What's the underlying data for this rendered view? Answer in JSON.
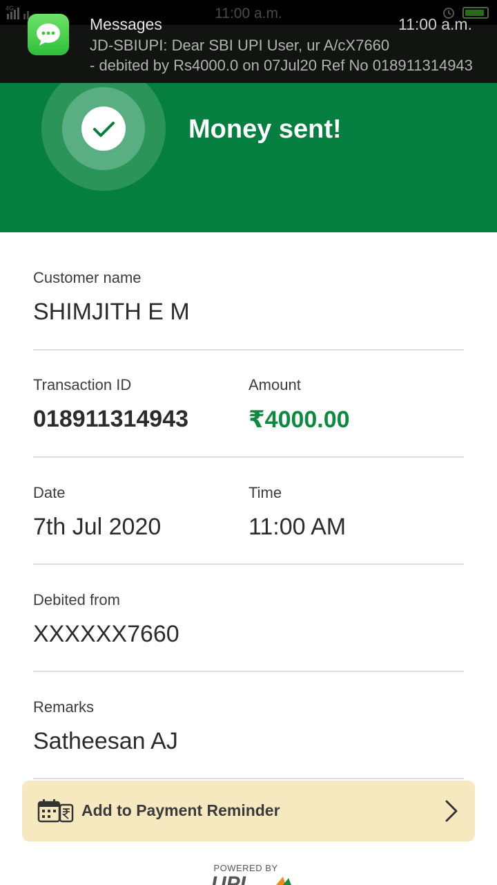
{
  "status_bar": {
    "time": "11:00 a.m.",
    "signal_label": "4G",
    "battery_level": 0.9,
    "battery_color": "#2a6a1a"
  },
  "notification": {
    "app_name": "Messages",
    "time": "11:00 a.m.",
    "line1": "JD-SBIUPI: Dear SBI UPI User, ur A/cX7660",
    "line2": "- debited by Rs4000.0 on 07Jul20 Ref No 018911314943",
    "icon": "messages-bubble-icon"
  },
  "header": {
    "title": "Money sent!",
    "icon": "checkmark-icon",
    "background_color": "#057f3f"
  },
  "details": {
    "customer_name_label": "Customer name",
    "customer_name": "SHIMJITH E M",
    "transaction_id_label": "Transaction ID",
    "transaction_id": "018911314943",
    "amount_label": "Amount",
    "amount": "₹4000.00",
    "amount_color": "#0c8a3f",
    "date_label": "Date",
    "date": "7th Jul 2020",
    "time_label": "Time",
    "time": "11:00 AM",
    "debited_from_label": "Debited from",
    "debited_from": "XXXXXX7660",
    "remarks_label": "Remarks",
    "remarks": "Satheesan AJ"
  },
  "reminder": {
    "label": "Add to Payment Reminder",
    "icon": "calendar-rupee-icon",
    "chevron": "chevron-right-icon",
    "background_color": "#f6e9c0"
  },
  "footer": {
    "powered_by": "POWERED BY",
    "logo_text": "UPI"
  }
}
